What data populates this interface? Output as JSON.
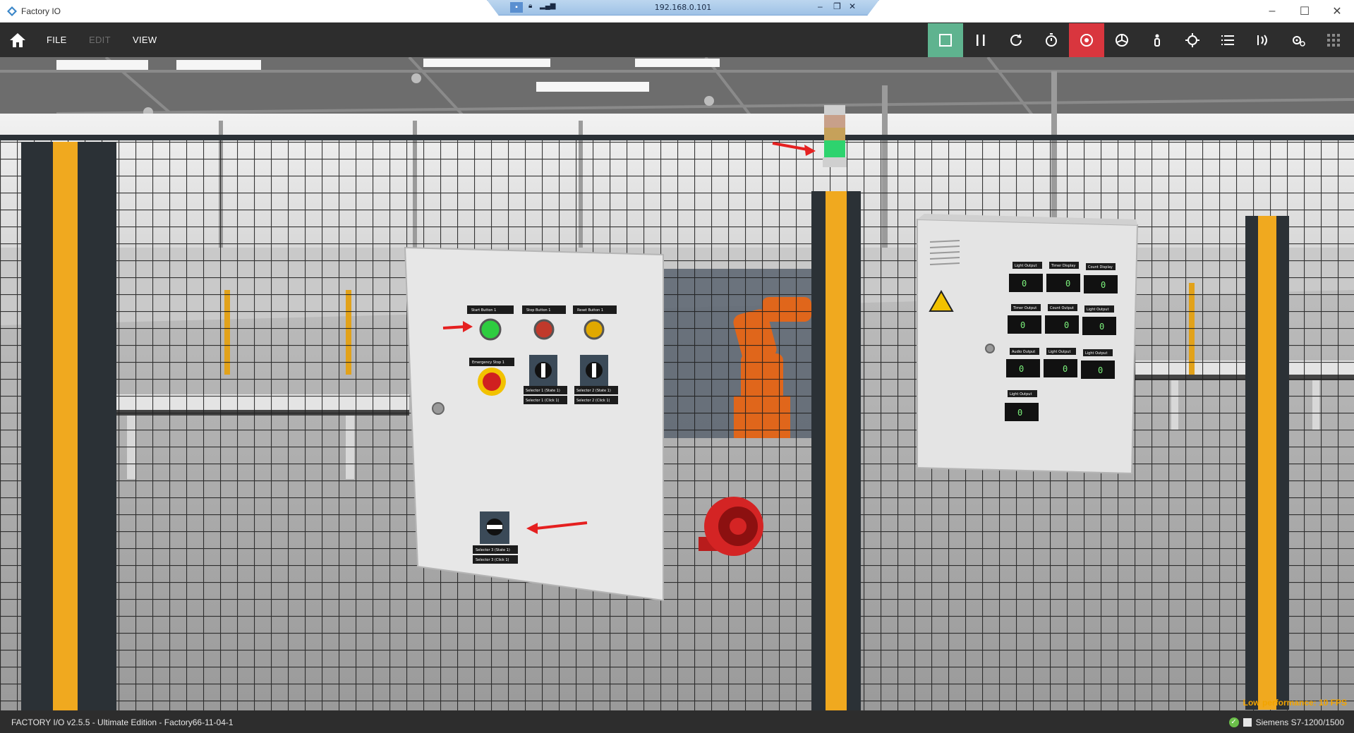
{
  "window": {
    "title": "Factory IO",
    "remote_ip": "192.168.0.101",
    "controls": [
      "minimize-icon",
      "maximize-icon",
      "close-icon"
    ]
  },
  "toolbar": {
    "menu": [
      {
        "label": "FILE",
        "enabled": true
      },
      {
        "label": "EDIT",
        "enabled": false
      },
      {
        "label": "VIEW",
        "enabled": true
      }
    ],
    "buttons": [
      {
        "icon": "edit-mode-icon",
        "active": true,
        "color": "#5fb38f"
      },
      {
        "icon": "pause-icon",
        "active": false
      },
      {
        "icon": "reset-icon",
        "active": false
      },
      {
        "icon": "timer-icon",
        "active": false
      },
      {
        "icon": "camera-orbit-icon",
        "active": true,
        "color": "#d9363e"
      },
      {
        "icon": "camera-fly-icon",
        "active": false
      },
      {
        "icon": "camera-first-person-icon",
        "active": false
      },
      {
        "icon": "focus-icon",
        "active": false
      },
      {
        "icon": "list-icon",
        "active": false
      },
      {
        "icon": "sensors-icon",
        "active": false
      },
      {
        "icon": "drivers-icon",
        "active": false
      },
      {
        "icon": "grid-icon",
        "active": false
      }
    ]
  },
  "scene": {
    "performance_warning": "Low performance: 10 FPS",
    "left_panel": {
      "lights": [
        {
          "label": "Start Button 1",
          "color": "#2ecc40"
        },
        {
          "label": "Stop Button 1",
          "color": "#c0392b"
        },
        {
          "label": "Reset Button 1",
          "color": "#e0a800"
        }
      ],
      "emergency_label": "Emergency Stop 1",
      "selectors": [
        "Selector 1 (State 1)",
        "Selector 2 (State 1)"
      ],
      "selector_sub": [
        "Selector 1 (Click 1)",
        "Selector 2 (Click 1)"
      ],
      "bottom_selector": "Selector 3 (State 1)",
      "bottom_selector_sub": "Selector 3 (Click 1)"
    },
    "right_panel": {
      "row1": [
        "Light Output",
        "Timer Display",
        "Count Display"
      ],
      "row2": [
        "Timer Output",
        "Count Output",
        "Light Output"
      ],
      "row3": [
        "Audio Output",
        "Light Output",
        "Light Output"
      ],
      "row4": [
        "Light Output"
      ],
      "display_values": [
        "0",
        "0",
        "0",
        "0",
        "0",
        "0",
        "0",
        "0",
        "0",
        "0"
      ]
    }
  },
  "statusbar": {
    "version": "FACTORY I/O v2.5.5 - Ultimate Edition - Factory66-11-04-1",
    "driver": "Siemens S7-1200/1500"
  }
}
